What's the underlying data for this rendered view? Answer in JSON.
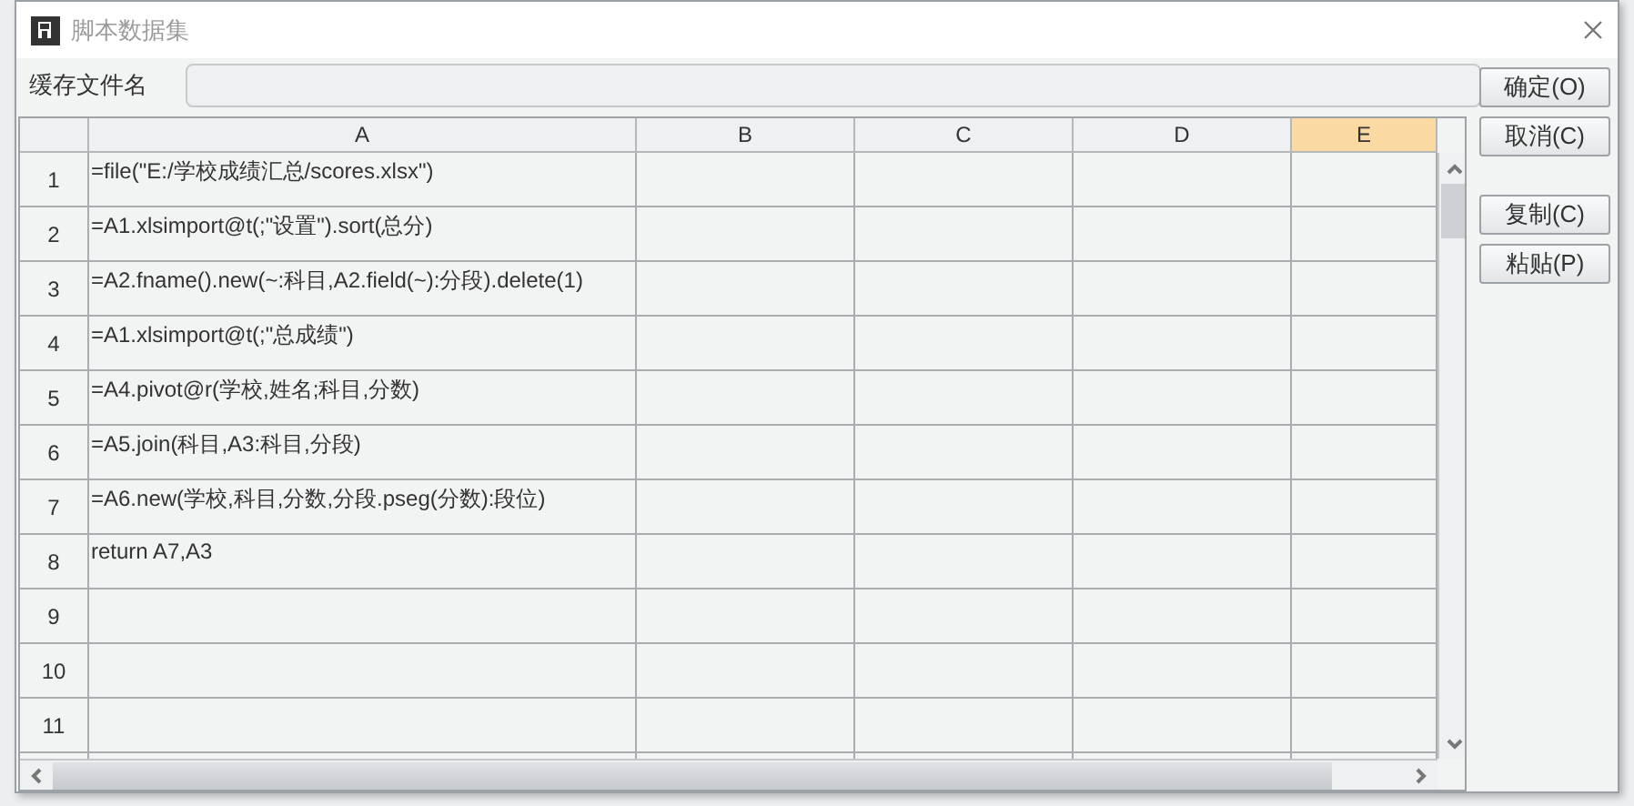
{
  "window": {
    "title": "脚本数据集"
  },
  "cache_field": {
    "label": "缓存文件名"
  },
  "grid": {
    "columns": [
      {
        "label": "A",
        "selected": false
      },
      {
        "label": "B",
        "selected": false
      },
      {
        "label": "C",
        "selected": false
      },
      {
        "label": "D",
        "selected": false
      },
      {
        "label": "E",
        "selected": true
      }
    ],
    "rows": [
      {
        "number": "1",
        "cell": "=file(\"E:/学校成绩汇总/scores.xlsx\")"
      },
      {
        "number": "2",
        "cell": "=A1.xlsimport@t(;\"设置\").sort(总分)"
      },
      {
        "number": "3",
        "cell": "=A2.fname().new(~:科目,A2.field(~):分段).delete(1)"
      },
      {
        "number": "4",
        "cell": "=A1.xlsimport@t(;\"总成绩\")"
      },
      {
        "number": "5",
        "cell": "=A4.pivot@r(学校,姓名;科目,分数)"
      },
      {
        "number": "6",
        "cell": "=A5.join(科目,A3:科目,分段)"
      },
      {
        "number": "7",
        "cell": "=A6.new(学校,科目,分数,分段.pseg(分数):段位)"
      },
      {
        "number": "8",
        "cell": "return A7,A3"
      },
      {
        "number": "9"
      },
      {
        "number": "10"
      },
      {
        "number": "11"
      }
    ]
  },
  "button_groups": [
    [
      {
        "label": "确定(O)"
      },
      {
        "label": "取消(C)"
      }
    ],
    [
      {
        "label": "复制(C)"
      },
      {
        "label": "粘贴(P)"
      }
    ]
  ]
}
